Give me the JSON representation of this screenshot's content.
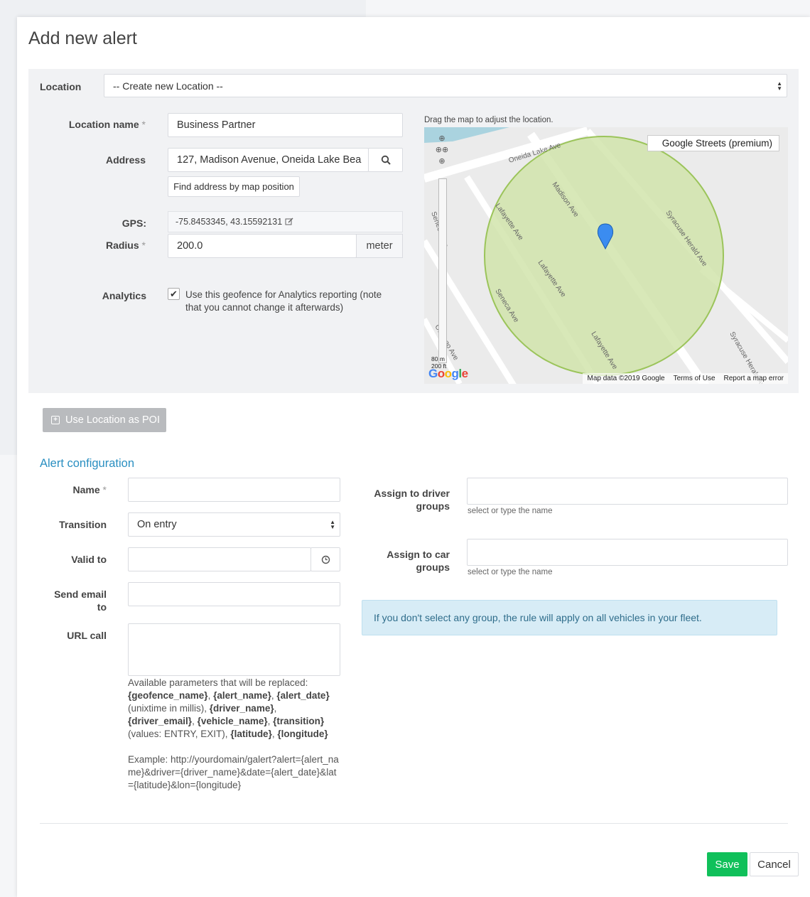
{
  "modal": {
    "title": "Add new alert"
  },
  "location": {
    "label": "Location",
    "selected": "-- Create new Location --",
    "name_label": "Location name",
    "name_value": "Business Partner",
    "address_label": "Address",
    "address_value": "127, Madison Avenue, Oneida Lake Bea",
    "find_button": "Find address by map position",
    "gps_label": "GPS:",
    "gps_value": "-75.8453345, 43.15592131",
    "radius_label": "Radius",
    "radius_value": "200.0",
    "radius_unit": "meter",
    "analytics_label": "Analytics",
    "analytics_checked": true,
    "analytics_text": "Use this geofence for Analytics reporting (note that you cannot change it afterwards)",
    "required_mark": "*"
  },
  "map": {
    "hint": "Drag the map to adjust the location.",
    "type_label": "Google Streets (premium)",
    "streets": [
      "Oneida Lake Ave",
      "Madison Ave",
      "Syracuse Herald Ave",
      "Lafayette Ave",
      "Seneca Ave",
      "Oswego Ave",
      "Madison Ave",
      "Lafayette Ave",
      "Syracuse Herald Ave",
      "Lafayette Ave",
      "Seneca Ave"
    ],
    "scale_m": "80 m",
    "scale_ft": "200 ft",
    "logo": "Google",
    "footer": [
      "Map data ©2019 Google",
      "Terms of Use",
      "Report a map error"
    ],
    "circle_color": "#cfe3a8",
    "pin_color": "#3b8cf0"
  },
  "poi_button": "Use Location as POI",
  "alert": {
    "section_title": "Alert configuration",
    "name_label": "Name",
    "transition_label": "Transition",
    "transition_value": "On entry",
    "valid_to_label": "Valid to",
    "email_label": "Send email to",
    "url_label": "URL call",
    "params_intro": "Available parameters that will be replaced:",
    "params": [
      "{geofence_name}",
      "{alert_name}",
      "{alert_date}",
      "{driver_name}",
      "{driver_email}",
      "{vehicle_name}",
      "{transition}",
      "{latitude}",
      "{longitude}"
    ],
    "unixtime_note": "(unixtime in millis),",
    "values_note": "(values: ENTRY, EXIT),",
    "example": "Example: http://yourdomain/galert?alert={alert_name}&driver={driver_name}&date={alert_date}&lat={latitude}&lon={longitude}",
    "driver_groups_label": "Assign to driver groups",
    "car_groups_label": "Assign to car groups",
    "groups_hint": "select or type the name",
    "info": "If you don't select any group, the rule will apply on all vehicles in your fleet."
  },
  "footer": {
    "save": "Save",
    "cancel": "Cancel"
  }
}
